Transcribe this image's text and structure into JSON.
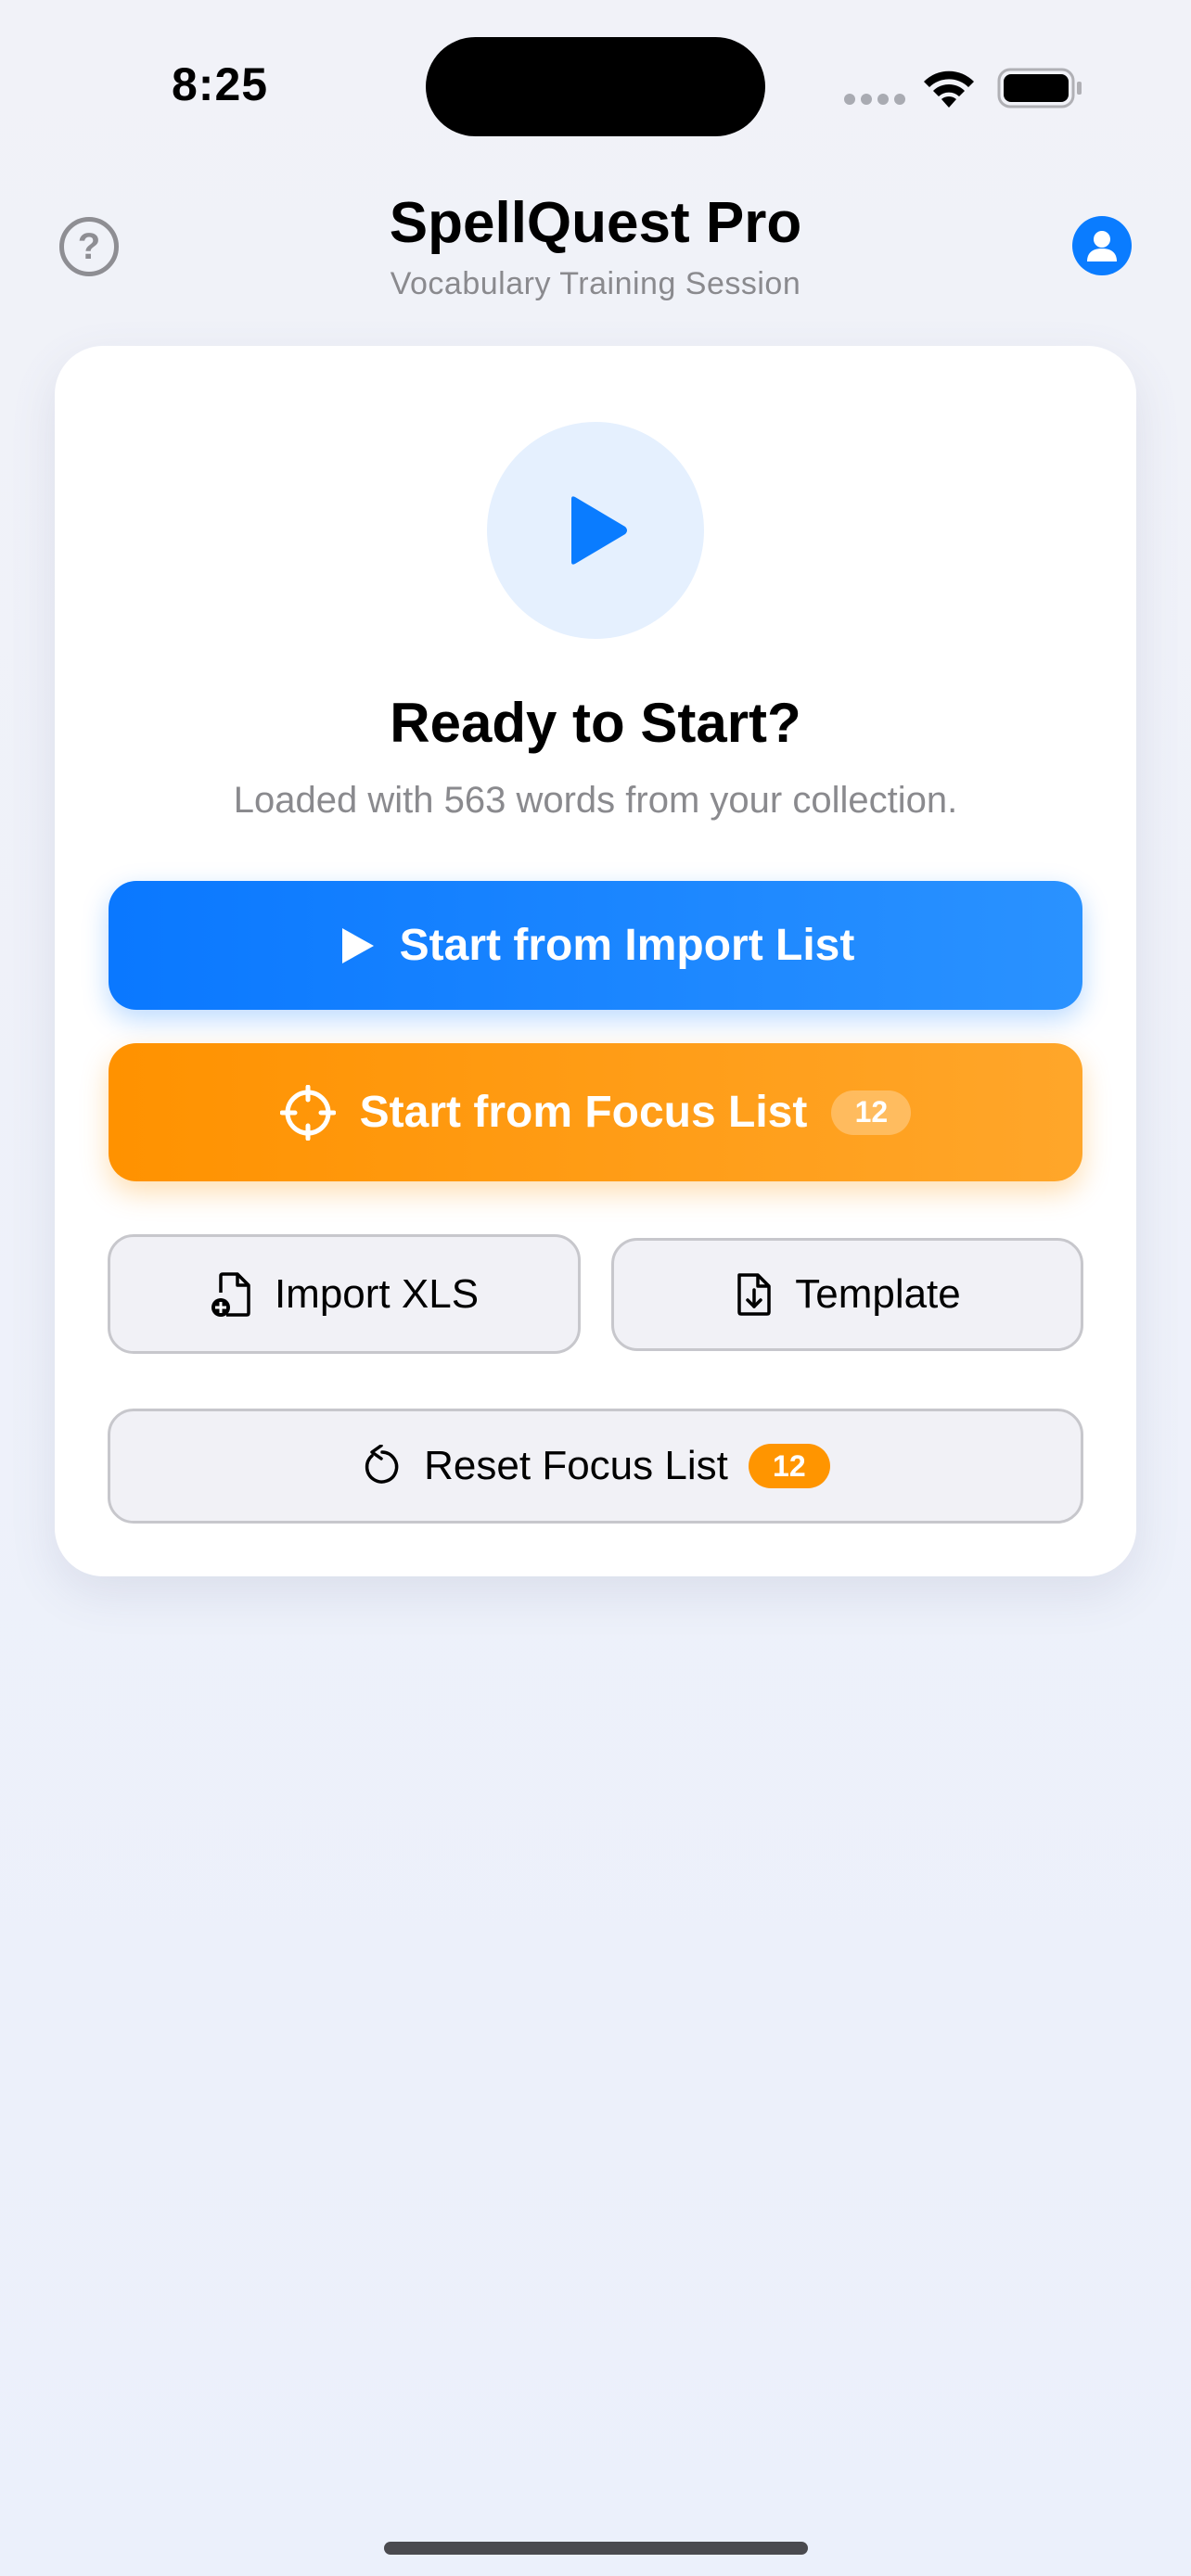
{
  "status_bar": {
    "time": "8:25"
  },
  "header": {
    "title": "SpellQuest Pro",
    "subtitle": "Vocabulary Training Session",
    "help_icon": "question-circle-icon",
    "help_glyph": "?",
    "profile_icon": "person-circle-icon"
  },
  "card": {
    "title": "Ready to Start?",
    "description": "Loaded with 563 words from your collection.",
    "start_import_label": "Start from Import List",
    "start_focus_label": "Start from Focus List",
    "focus_count": "12",
    "import_xls_label": "Import XLS",
    "template_label": "Template",
    "reset_focus_label": "Reset Focus List",
    "reset_count": "12"
  },
  "colors": {
    "primary": "#0a7cff",
    "focus": "#ff9500",
    "muted_text": "#8a8a8e",
    "background": "#eef1f9"
  }
}
